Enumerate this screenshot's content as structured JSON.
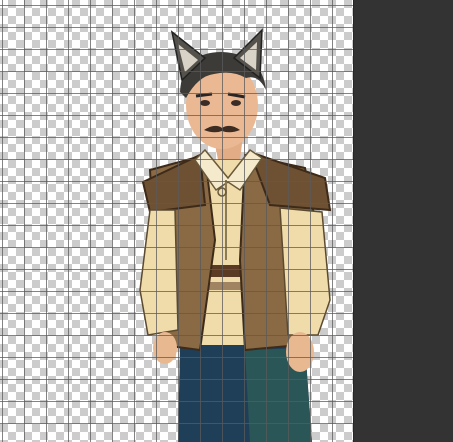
{
  "colors": {
    "panel_background": "#333333",
    "checker_light": "#ffffff",
    "checker_dark": "#cccccc",
    "grid_line": "#5a5a5a"
  },
  "canvas": {
    "sprite": "wolf-eared-man-character-sprite",
    "transparent_background": true,
    "grid_visible": true
  }
}
